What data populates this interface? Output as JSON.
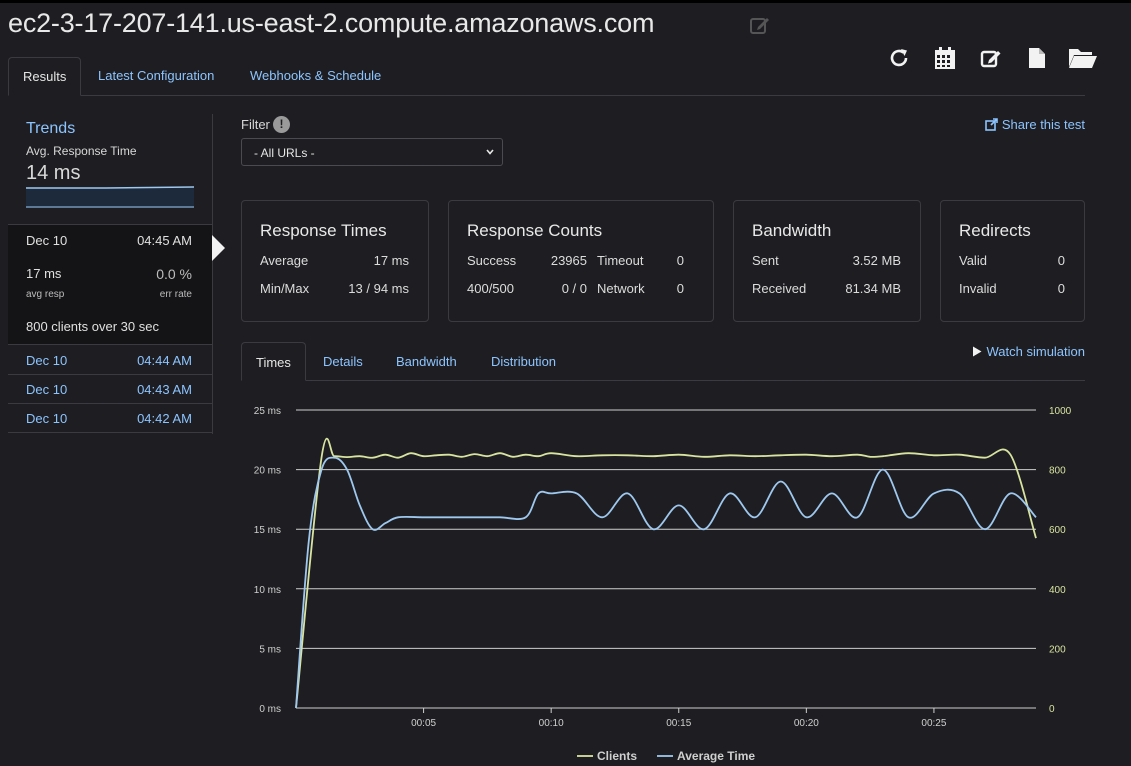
{
  "header": {
    "host": "ec2-3-17-207-141.us-east-2.compute.amazonaws.com",
    "toolbar_icons": [
      "refresh-icon",
      "calendar-icon",
      "edit-icon",
      "file-icon",
      "folder-open-icon"
    ]
  },
  "tabs": [
    {
      "label": "Results",
      "active": true
    },
    {
      "label": "Latest Configuration",
      "active": false
    },
    {
      "label": "Webhooks & Schedule",
      "active": false
    }
  ],
  "sidebar": {
    "title": "Trends",
    "metric_label": "Avg. Response Time",
    "metric_value": "14 ms",
    "active_run": {
      "date": "Dec 10",
      "time": "04:45 AM",
      "avg_resp": "17 ms",
      "avg_resp_label": "avg resp",
      "err_rate": "0.0 %",
      "err_rate_label": "err rate",
      "clients_summary": "800 clients over 30 sec"
    },
    "runs": [
      {
        "date": "Dec 10",
        "time": "04:44 AM"
      },
      {
        "date": "Dec 10",
        "time": "04:43 AM"
      },
      {
        "date": "Dec 10",
        "time": "04:42 AM"
      }
    ]
  },
  "filter": {
    "label": "Filter",
    "info": "!",
    "selected": "- All URLs -"
  },
  "share_label": "Share this test",
  "cards": {
    "response_times": {
      "title": "Response Times",
      "average_label": "Average",
      "average_value": "17 ms",
      "minmax_label": "Min/Max",
      "minmax_value": "13 / 94 ms"
    },
    "response_counts": {
      "title": "Response Counts",
      "success_label": "Success",
      "success_value": "23965",
      "timeout_label": "Timeout",
      "timeout_value": "0",
      "errors_label": "400/500",
      "errors_value": "0 / 0",
      "network_label": "Network",
      "network_value": "0"
    },
    "bandwidth": {
      "title": "Bandwidth",
      "sent_label": "Sent",
      "sent_value": "3.52 MB",
      "received_label": "Received",
      "received_value": "81.34 MB"
    },
    "redirects": {
      "title": "Redirects",
      "valid_label": "Valid",
      "valid_value": "0",
      "invalid_label": "Invalid",
      "invalid_value": "0"
    }
  },
  "chart_tabs": [
    {
      "label": "Times",
      "active": true
    },
    {
      "label": "Details",
      "active": false
    },
    {
      "label": "Bandwidth",
      "active": false
    },
    {
      "label": "Distribution",
      "active": false
    }
  ],
  "watch_label": "Watch simulation",
  "colors": {
    "clients": "#d9e3a0",
    "average_time": "#9ec8ef",
    "link": "#8cc4ff"
  },
  "chart_data": {
    "type": "line",
    "x_ticks": [
      "00:05",
      "00:10",
      "00:15",
      "00:20",
      "00:25"
    ],
    "xlim": [
      0,
      29
    ],
    "y_left_ticks": [
      "0 ms",
      "5 ms",
      "10 ms",
      "15 ms",
      "20 ms",
      "25 ms"
    ],
    "y_left_lim": [
      0,
      25
    ],
    "y_right_ticks": [
      "0",
      "200",
      "400",
      "600",
      "800",
      "1000"
    ],
    "y_right_lim": [
      0,
      1000
    ],
    "grid": true,
    "legend_position": "bottom-center",
    "series": [
      {
        "name": "Clients",
        "axis": "right",
        "x": [
          0,
          1,
          1.5,
          2,
          2.5,
          3,
          3.5,
          4,
          4.5,
          5,
          5.5,
          6,
          6.5,
          7,
          7.5,
          8,
          8.5,
          9,
          9.5,
          10,
          11,
          12,
          13,
          14,
          15,
          16,
          17,
          18,
          19,
          20,
          21,
          22,
          22.5,
          23,
          24,
          25,
          26,
          27,
          28,
          29
        ],
        "values": [
          0,
          840,
          845,
          842,
          845,
          840,
          850,
          840,
          855,
          845,
          848,
          850,
          843,
          852,
          845,
          855,
          843,
          850,
          845,
          855,
          845,
          848,
          848,
          845,
          850,
          843,
          848,
          845,
          848,
          850,
          845,
          850,
          843,
          845,
          855,
          848,
          850,
          840,
          850,
          570
        ]
      },
      {
        "name": "Average Time",
        "axis": "left",
        "x": [
          0,
          0.5,
          1,
          1.5,
          2,
          2.5,
          3,
          3.5,
          4,
          5,
          6,
          7,
          8,
          9,
          9.5,
          10,
          11,
          12,
          13,
          14,
          15,
          16,
          17,
          18,
          19,
          20,
          21,
          22,
          23,
          24,
          25,
          26,
          27,
          28,
          29
        ],
        "values": [
          0,
          14,
          20,
          21,
          20,
          17,
          15,
          15.5,
          16,
          16,
          16,
          16,
          16,
          16,
          18,
          18,
          18,
          16,
          18,
          15,
          17,
          15,
          18,
          16,
          19,
          16,
          18,
          16,
          20,
          16,
          18,
          18,
          15,
          18,
          16
        ]
      }
    ]
  }
}
